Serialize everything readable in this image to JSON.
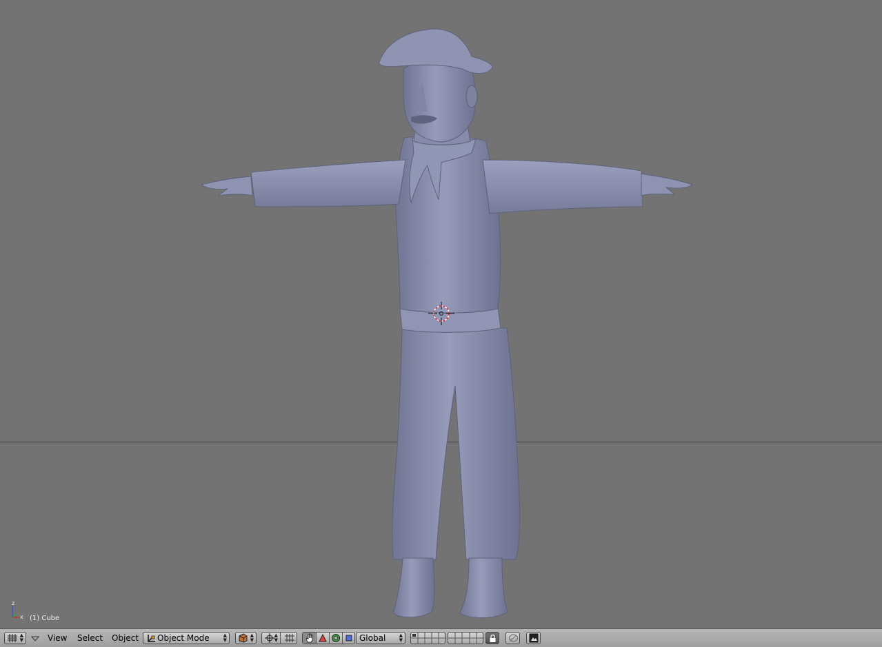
{
  "viewport": {
    "object_label": "(1) Cube",
    "axis_labels": {
      "z": "z",
      "x": "x"
    },
    "background_color": "#737373",
    "mesh_color": "#8d93b0",
    "horizon_color": "#3d3d3d"
  },
  "header": {
    "editor_type_icon": "grid-icon",
    "menus": {
      "view": "View",
      "select": "Select",
      "object": "Object"
    },
    "mode_select": {
      "value": "Object Mode",
      "icon": "object-mode-icon"
    },
    "shading_icon": "solid-draw-type-icon",
    "pivot_icon": "pivot-point-icon",
    "snap_icon": "snap-icon",
    "manipulator_icons": [
      "hand-icon",
      "translate-icon",
      "rotate-icon",
      "scale-icon"
    ],
    "orientation_select": {
      "value": "Global"
    },
    "layer_icons": [
      "layers-icon"
    ],
    "lock_icon": "lock-icon",
    "render_icons": [
      "opengl-render-icon",
      "render-preview-icon"
    ]
  }
}
